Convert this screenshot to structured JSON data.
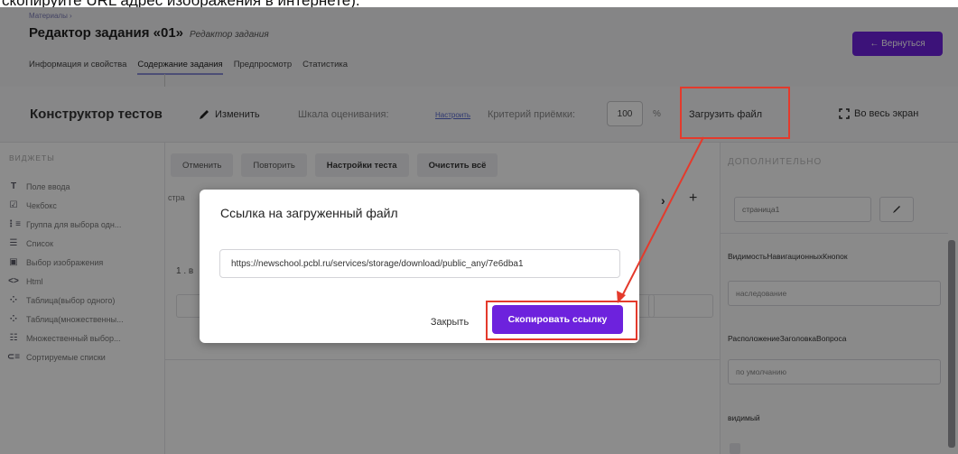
{
  "caption": "скопируйте URL адрес изображения в интернете).",
  "header": {
    "breadcrumb": "Материалы ›",
    "title": "Редактор задания «01»",
    "subtitle": "Редактор задания",
    "back_button": "← Вернуться",
    "tabs": [
      {
        "label": "Информация и свойства"
      },
      {
        "label": "Содержание задания"
      },
      {
        "label": "Предпросмотр"
      },
      {
        "label": "Статистика"
      }
    ]
  },
  "toolbar": {
    "title": "Конструктор тестов",
    "edit": "Изменить",
    "scale_label": "Шкала оценивания:",
    "configure": "Настроить",
    "criteria_label": "Критерий приёмки:",
    "criteria_value": "100",
    "percent": "%",
    "upload": "Загрузить файл",
    "fullscreen": "Во весь экран"
  },
  "sidebar": {
    "heading": "ВИДЖЕТЫ",
    "items": [
      {
        "label": "Поле ввода",
        "icon": "T"
      },
      {
        "label": "Чекбокс",
        "icon": "☑"
      },
      {
        "label": "Группа для выбора одн...",
        "icon": "⋮≡"
      },
      {
        "label": "Список",
        "icon": "☰"
      },
      {
        "label": "Выбор изображения",
        "icon": "▣"
      },
      {
        "label": "Html",
        "icon": "<>"
      },
      {
        "label": "Таблица(выбор одного)",
        "icon": "⁘"
      },
      {
        "label": "Таблица(множественны...",
        "icon": "⁘"
      },
      {
        "label": "Множественный выбор...",
        "icon": "☷"
      },
      {
        "label": "Сортируемые списки",
        "icon": "⊂≡"
      }
    ]
  },
  "center": {
    "buttons": [
      {
        "label": "Отменить"
      },
      {
        "label": "Повторить"
      },
      {
        "label": "Настройки теста"
      },
      {
        "label": "Очистить всё"
      }
    ],
    "page_tab": "стра",
    "question_prefix": "1 . в"
  },
  "right": {
    "heading": "ДОПОЛНИТЕЛЬНО",
    "page_name": "страница1",
    "nav_buttons_label": "ВидимостьНавигационныхКнопок",
    "nav_buttons_value": "наследование",
    "title_position_label": "РасположениеЗаголовкаВопроса",
    "title_position_value": "по умолчанию",
    "visible_label": "видимый"
  },
  "modal": {
    "title": "Ссылка на загруженный файл",
    "url": "https://newschool.pcbl.ru/services/storage/download/public_any/7e6dba1",
    "close": "Закрыть",
    "copy": "Скопировать ссылку"
  },
  "colors": {
    "accent": "#6d22dd",
    "highlight": "#e43a2c"
  }
}
